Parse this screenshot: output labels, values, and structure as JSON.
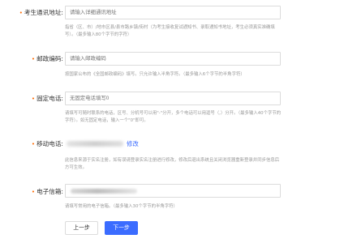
{
  "form": {
    "address": {
      "required_mark": "•",
      "label": "考生通讯地址:",
      "placeholder": "请输入详细通讯地址",
      "hint": "指省（区、市）/地市区县/县市路乡镇/街村（为考生接收复试通知书、录取通知书地址，考生必须真实准确填写）。（最多输入80个字节的字符）"
    },
    "postcode": {
      "required_mark": "•",
      "label": "邮政编码:",
      "placeholder": "请输入邮政编码",
      "hint": "按国家公布的《全国邮政编码》填写。只允许输入半角字符。（最多输入6个字节的半角字符）"
    },
    "landline": {
      "required_mark": "•",
      "label": "固定电话:",
      "placeholder": "无固定电话填写0",
      "hint": "请填写可随时联系的电话，区号、分机号可以用\"-\"分开，多个电话可以用逗号（,）分开。（最多输入40个字节的字符）。如无固定电话，输入一个\"0\"即可。"
    },
    "mobile": {
      "required_mark": "•",
      "label": "移动电话:",
      "modify_link": "修改",
      "hint": "此信息来源于实名注册，如有误请登录实名注册进行修改，修改后退出系统且关闭浏览器重新登录并同步信息后方可生效。"
    },
    "email": {
      "required_mark": "•",
      "label": "电子信箱:",
      "hint": "请填写常用的电子信箱。（最多输入30个字节的半角字符）"
    },
    "buttons": {
      "prev": "上一步",
      "next": "下一步"
    }
  },
  "colors": {
    "accent": "#3b6cff",
    "required": "#ff6a00"
  }
}
